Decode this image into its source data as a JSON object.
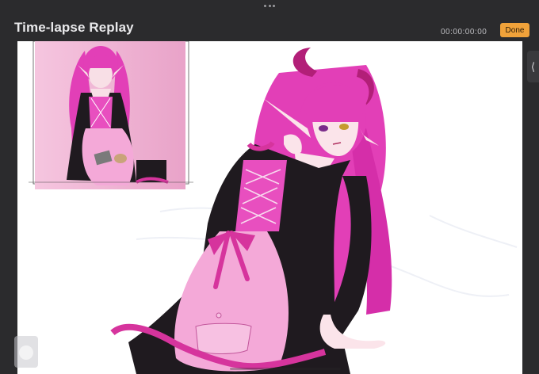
{
  "header": {
    "title": "Time-lapse Replay",
    "timecode": "00:00:00:00",
    "done_label": "Done"
  },
  "colors": {
    "accent": "#f0a23a",
    "background": "#2b2b2d",
    "canvas": "#ffffff",
    "hair": "#e23fb7",
    "dress": "#1f1a1f",
    "apron": "#f4a9d8",
    "ribbon": "#d6349d",
    "reference_bg": "#f3b7d7"
  },
  "icons": {
    "grabber": "more-dots-icon",
    "side_tab": "chevron-left-icon",
    "slider": "scrub-handle-icon"
  }
}
